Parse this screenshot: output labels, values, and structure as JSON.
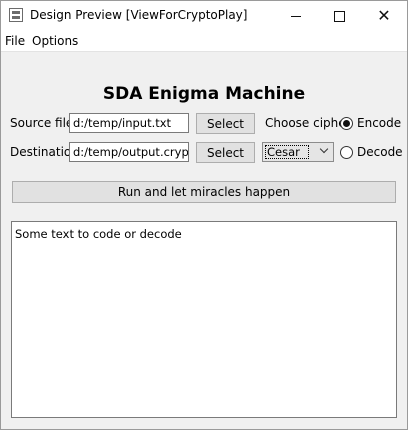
{
  "window": {
    "title": "Design Preview [ViewForCryptoPlay]",
    "controls": {
      "minimize": "minimize",
      "maximize": "maximize",
      "close": "✕"
    }
  },
  "menu": {
    "file": "File",
    "options": "Options"
  },
  "form": {
    "heading": "SDA Enigma Machine",
    "source": {
      "label": "Source file",
      "value": "d:/temp/input.txt",
      "button": "Select"
    },
    "destination": {
      "label": "Destination",
      "value": "d:/temp/output.crypt",
      "button": "Select"
    },
    "cipher": {
      "label": "Choose cipher",
      "selected": "Cesar"
    },
    "mode": {
      "encode": "Encode",
      "decode": "Decode",
      "selected": "Encode"
    },
    "run_button": "Run and let miracles happen",
    "text": "Some text to code or decode"
  },
  "colors": {
    "window_bg": "#f0f0f0",
    "titlebar_bg": "#ffffff",
    "button_bg": "#e1e1e1"
  }
}
